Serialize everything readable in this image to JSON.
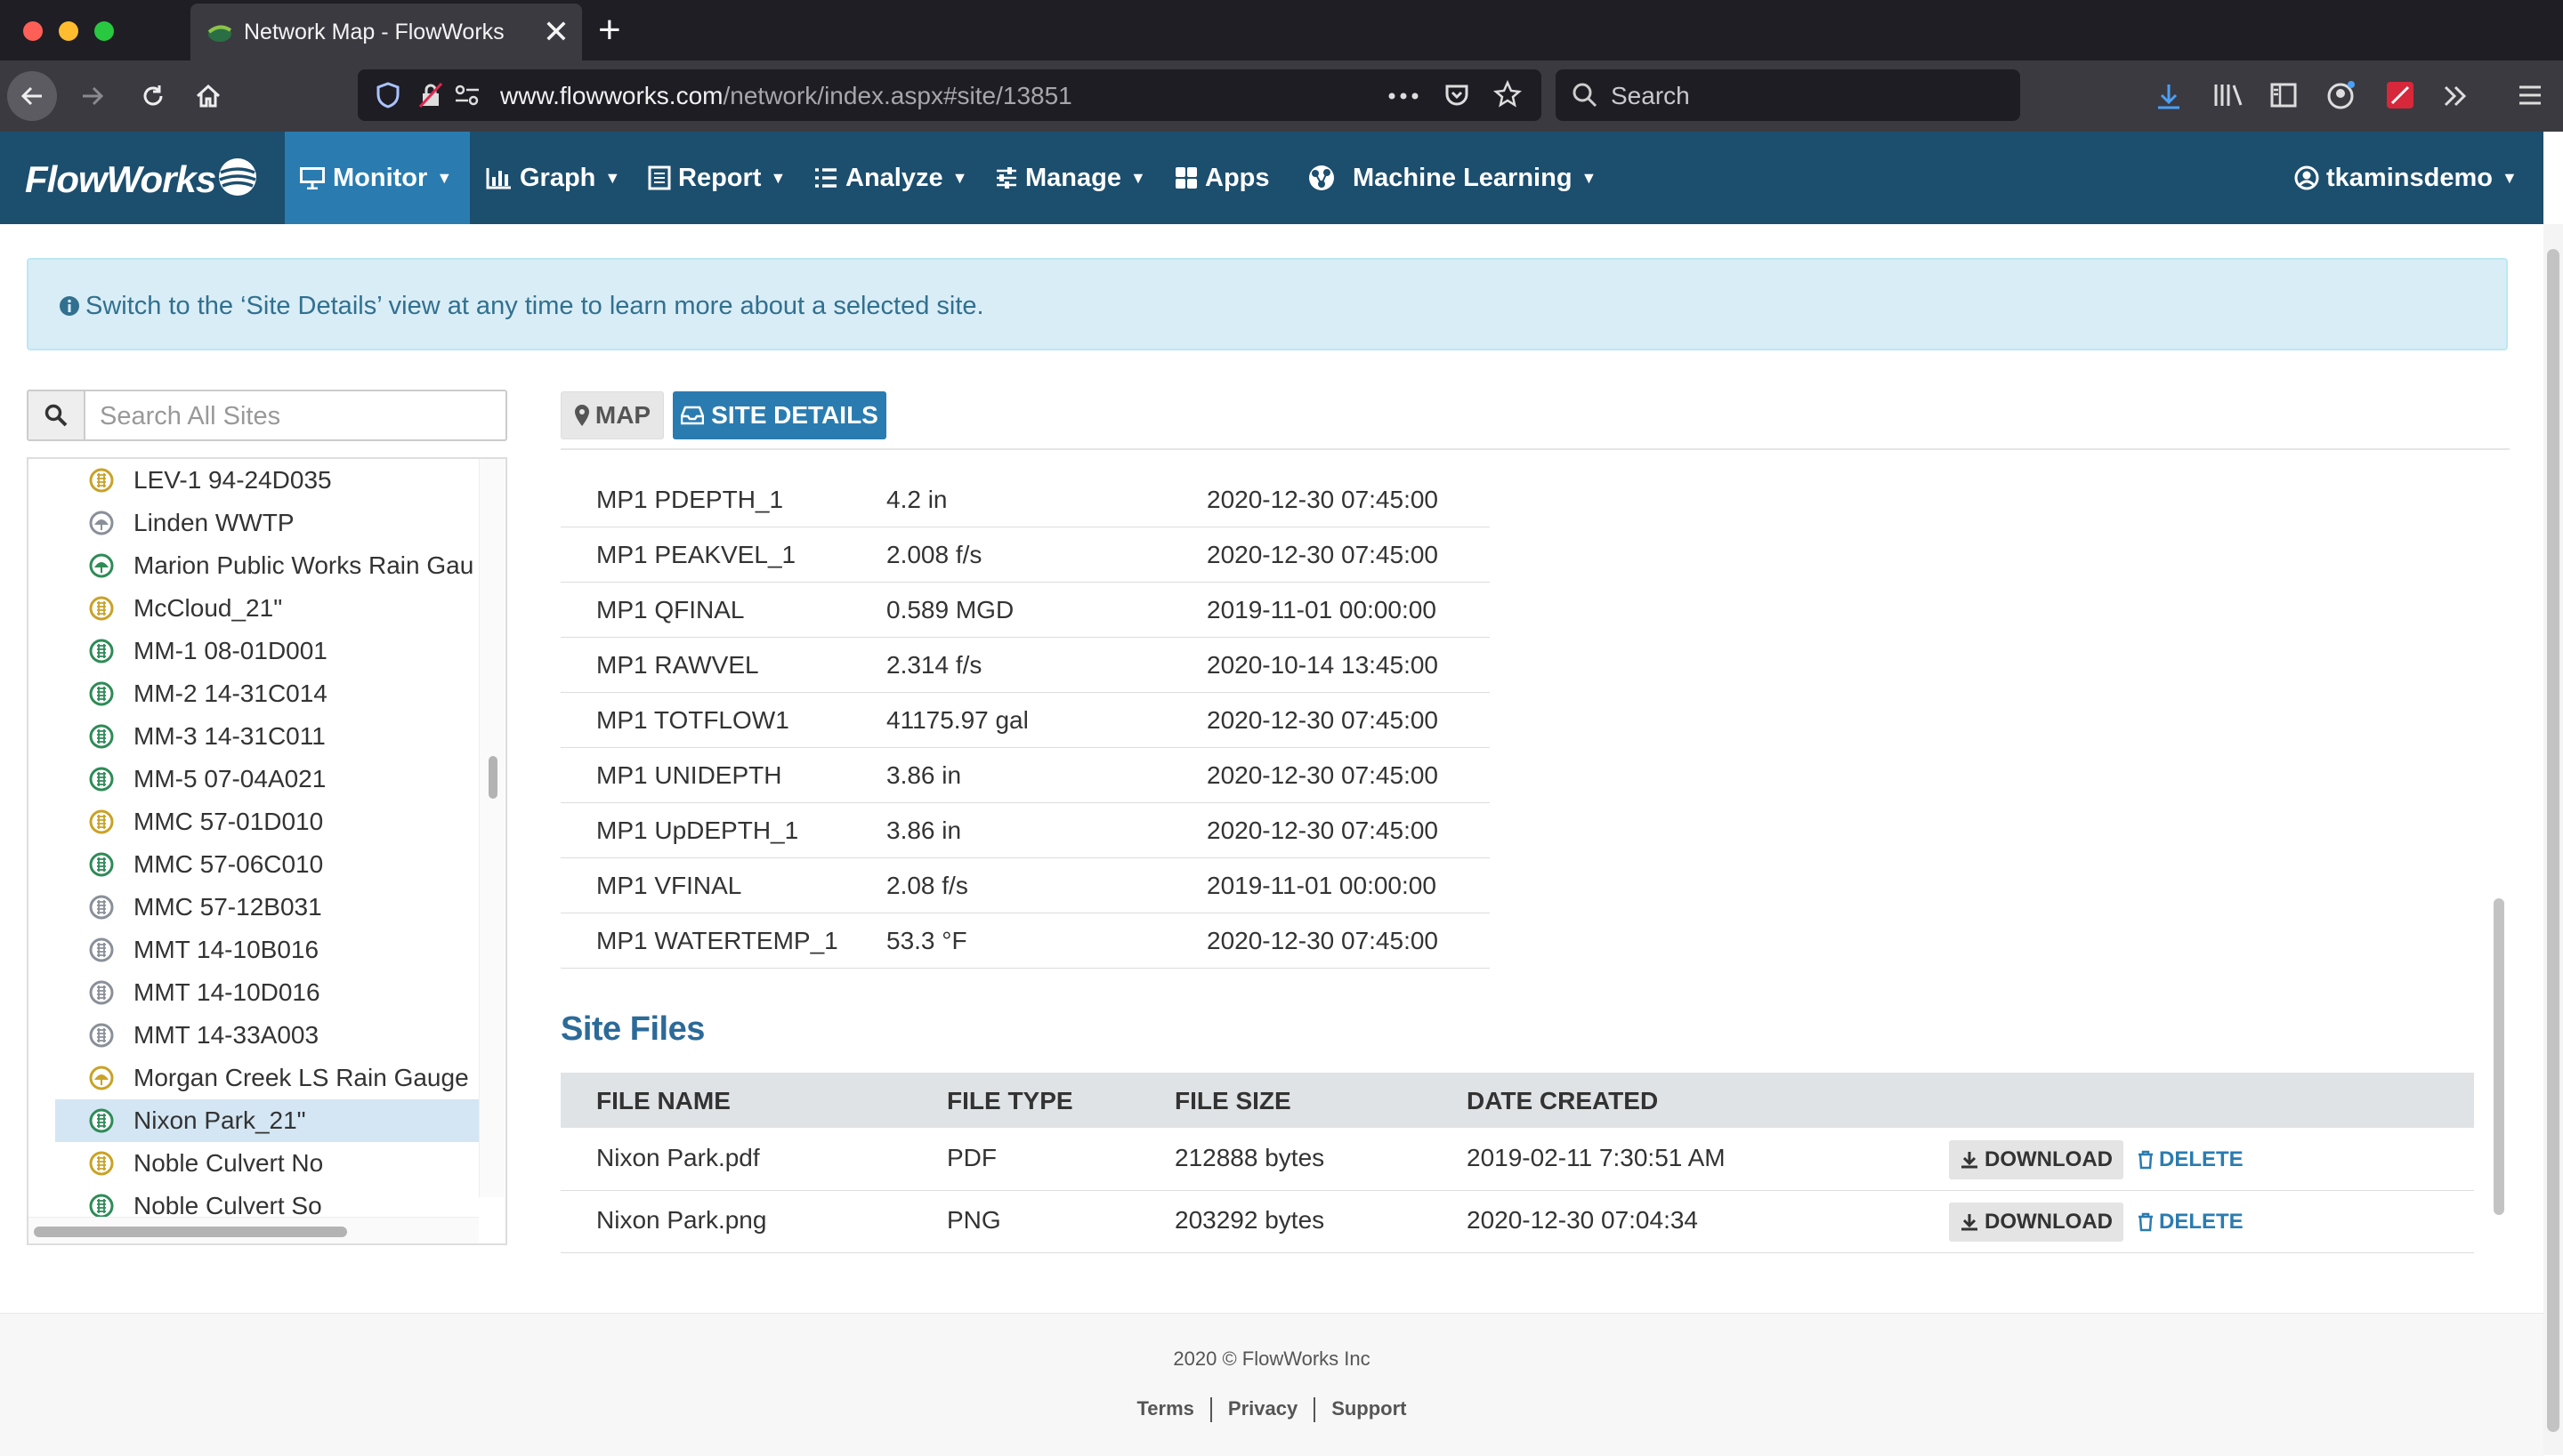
{
  "browser": {
    "tab_title": "Network Map - FlowWorks",
    "url_domain": "www.flowworks.com",
    "url_path": "/network/index.aspx#site/13851",
    "search_placeholder": "Search",
    "new_tab_label": "+",
    "close_label": "✕"
  },
  "app": {
    "logo": "FlowWorks",
    "menu": {
      "monitor": "Monitor",
      "graph": "Graph",
      "report": "Report",
      "analyze": "Analyze",
      "manage": "Manage",
      "apps": "Apps",
      "machine_learning": "Machine Learning",
      "user": "tkaminsdemo"
    },
    "brand_color": "#1c4e6e",
    "accent_color": "#2a7cb0"
  },
  "alert": {
    "text": "Switch to the ‘Site Details’ view at any time to learn more about a selected site."
  },
  "sidebar": {
    "search_placeholder": "Search All Sites",
    "sites": [
      {
        "name": "LEV-1 94-24D035",
        "icon": "yellow-meter-icon"
      },
      {
        "name": "Linden WWTP",
        "icon": "gray-rain-gauge-icon"
      },
      {
        "name": "Marion Public Works Rain Gau",
        "icon": "green-rain-gauge-icon"
      },
      {
        "name": "McCloud_21\"",
        "icon": "yellow-meter-icon"
      },
      {
        "name": "MM-1 08-01D001",
        "icon": "green-meter-icon"
      },
      {
        "name": "MM-2 14-31C014",
        "icon": "green-meter-icon"
      },
      {
        "name": "MM-3 14-31C011",
        "icon": "green-meter-icon"
      },
      {
        "name": "MM-5 07-04A021",
        "icon": "green-meter-icon"
      },
      {
        "name": "MMC 57-01D010",
        "icon": "yellow-meter-icon"
      },
      {
        "name": "MMC 57-06C010",
        "icon": "green-meter-icon"
      },
      {
        "name": "MMC 57-12B031",
        "icon": "gray-meter-icon"
      },
      {
        "name": "MMT 14-10B016",
        "icon": "gray-meter-icon"
      },
      {
        "name": "MMT 14-10D016",
        "icon": "gray-meter-icon"
      },
      {
        "name": "MMT 14-33A003",
        "icon": "gray-meter-icon"
      },
      {
        "name": "Morgan Creek LS Rain Gauge",
        "icon": "yellow-rain-gauge-icon"
      },
      {
        "name": "Nixon Park_21\"",
        "icon": "green-meter-icon",
        "selected": true
      },
      {
        "name": "Noble Culvert No",
        "icon": "yellow-meter-icon"
      },
      {
        "name": "Noble Culvert So",
        "icon": "green-meter-icon"
      }
    ]
  },
  "tabs": {
    "map": "MAP",
    "site_details": "SITE DETAILS"
  },
  "channels": [
    {
      "name": "MP1 PDEPTH_1",
      "value": "4.2 in",
      "date": "2020-12-30 07:45:00"
    },
    {
      "name": "MP1 PEAKVEL_1",
      "value": "2.008 f/s",
      "date": "2020-12-30 07:45:00"
    },
    {
      "name": "MP1 QFINAL",
      "value": "0.589 MGD",
      "date": "2019-11-01 00:00:00"
    },
    {
      "name": "MP1 RAWVEL",
      "value": "2.314 f/s",
      "date": "2020-10-14 13:45:00"
    },
    {
      "name": "MP1 TOTFLOW1",
      "value": "41175.97 gal",
      "date": "2020-12-30 07:45:00"
    },
    {
      "name": "MP1 UNIDEPTH",
      "value": "3.86 in",
      "date": "2020-12-30 07:45:00"
    },
    {
      "name": "MP1 UpDEPTH_1",
      "value": "3.86 in",
      "date": "2020-12-30 07:45:00"
    },
    {
      "name": "MP1 VFINAL",
      "value": "2.08 f/s",
      "date": "2019-11-01 00:00:00"
    },
    {
      "name": "MP1 WATERTEMP_1",
      "value": "53.3 °F",
      "date": "2020-12-30 07:45:00"
    }
  ],
  "site_files": {
    "title": "Site Files",
    "headers": [
      "FILE NAME",
      "FILE TYPE",
      "FILE SIZE",
      "DATE CREATED"
    ],
    "download_label": "DOWNLOAD",
    "delete_label": "DELETE",
    "rows": [
      {
        "name": "Nixon Park.pdf",
        "type": "PDF",
        "size": "212888 bytes",
        "created": "2019-02-11 7:30:51 AM"
      },
      {
        "name": "Nixon Park.png",
        "type": "PNG",
        "size": "203292 bytes",
        "created": "2020-12-30 07:04:34"
      }
    ]
  },
  "footer": {
    "copyright": "2020 © FlowWorks Inc",
    "links": [
      "Terms",
      "Privacy",
      "Support"
    ]
  }
}
